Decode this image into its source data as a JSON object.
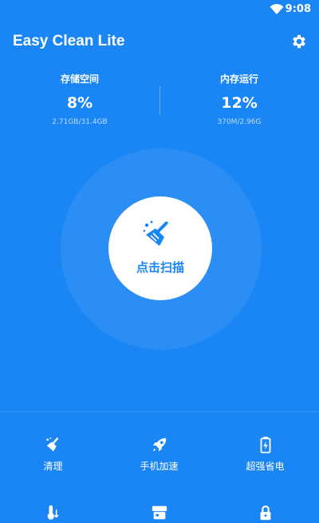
{
  "status_bar": {
    "time": "9:08",
    "wifi_icon": "wifi-icon"
  },
  "header": {
    "title": "Easy Clean Lite",
    "settings_icon": "gear-icon"
  },
  "stats": [
    {
      "label": "存储空间",
      "percent": "8%",
      "detail": "2.71GB/31.4GB"
    },
    {
      "label": "内存运行",
      "percent": "12%",
      "detail": "370M/2.96G"
    }
  ],
  "scan": {
    "label": "点击扫描",
    "icon": "broom-icon"
  },
  "features": [
    {
      "label": "清理",
      "icon": "broom-icon"
    },
    {
      "label": "手机加速",
      "icon": "rocket-icon"
    },
    {
      "label": "超强省电",
      "icon": "battery-icon"
    },
    {
      "label": "",
      "icon": "thermometer-icon"
    },
    {
      "label": "",
      "icon": "apps-icon"
    },
    {
      "label": "",
      "icon": "lock-icon"
    }
  ],
  "colors": {
    "primary": "#1a86f5",
    "on_primary": "#ffffff"
  }
}
